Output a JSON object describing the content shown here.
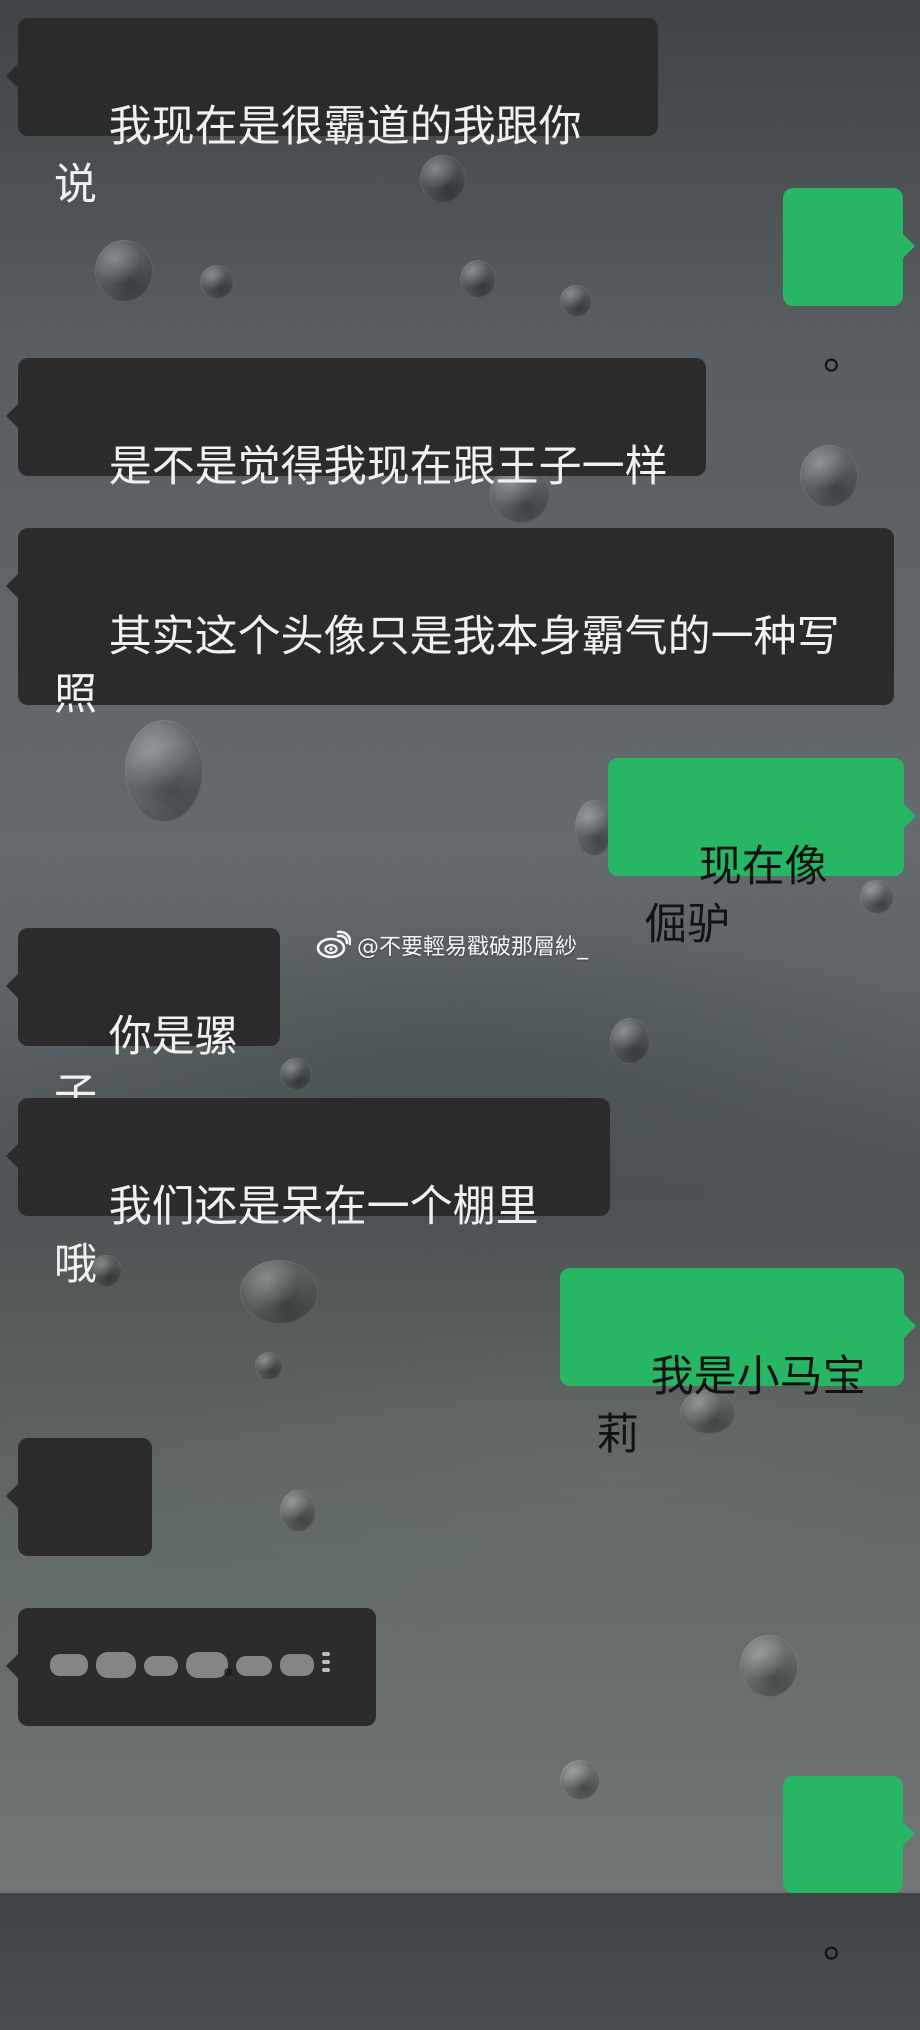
{
  "watermark": {
    "icon": "weibo-icon",
    "text": "@不要輕易戳破那層紗_"
  },
  "messages": [
    {
      "side": "in",
      "text": "我现在是很霸道的我跟你说"
    },
    {
      "side": "out",
      "text": "。"
    },
    {
      "side": "in",
      "text": "是不是觉得我现在跟王子一样"
    },
    {
      "side": "in",
      "text": "其实这个头像只是我本身霸气的一种写照"
    },
    {
      "side": "out",
      "text": "现在像倔驴"
    },
    {
      "side": "in",
      "text": "你是骡子"
    },
    {
      "side": "in",
      "text": "我们还是呆在一个棚里哦"
    },
    {
      "side": "out",
      "text": "我是小马宝莉"
    },
    {
      "side": "in",
      "text": "。"
    },
    {
      "side": "in",
      "text": ""
    },
    {
      "side": "out",
      "text": "。"
    }
  ],
  "colors": {
    "incoming_bubble": "#2b2b2b",
    "outgoing_bubble": "#26b664",
    "incoming_text": "#f1f1f1",
    "outgoing_text": "#121212"
  }
}
